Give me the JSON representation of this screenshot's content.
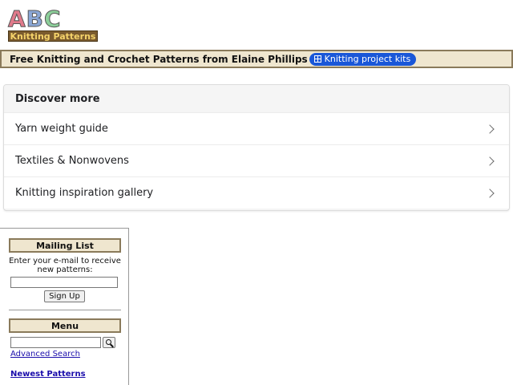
{
  "logo": {
    "letters": [
      "A",
      "B",
      "C"
    ],
    "subtitle": "Knitting Patterns"
  },
  "banner": {
    "title": "Free Knitting and Crochet Patterns from Elaine Phillips",
    "chip_label": "Knitting project kits",
    "chip_icon": "grid-icon",
    "colors": {
      "banner_bg": "#efe6cf",
      "chip_bg": "#1a57d8"
    }
  },
  "discover": {
    "header": "Discover more",
    "items": [
      {
        "label": "Yarn weight guide"
      },
      {
        "label": "Textiles & Nonwovens"
      },
      {
        "label": "Knitting inspiration gallery"
      }
    ]
  },
  "sidebar": {
    "mailing_list": {
      "header": "Mailing List",
      "text": "Enter your e-mail to receive new patterns:",
      "email_value": "",
      "button_label": "Sign Up"
    },
    "menu": {
      "header": "Menu",
      "search_value": "",
      "search_icon": "search-icon",
      "advanced_search_label": "Advanced Search",
      "newest_patterns_label": "Newest Patterns"
    }
  }
}
